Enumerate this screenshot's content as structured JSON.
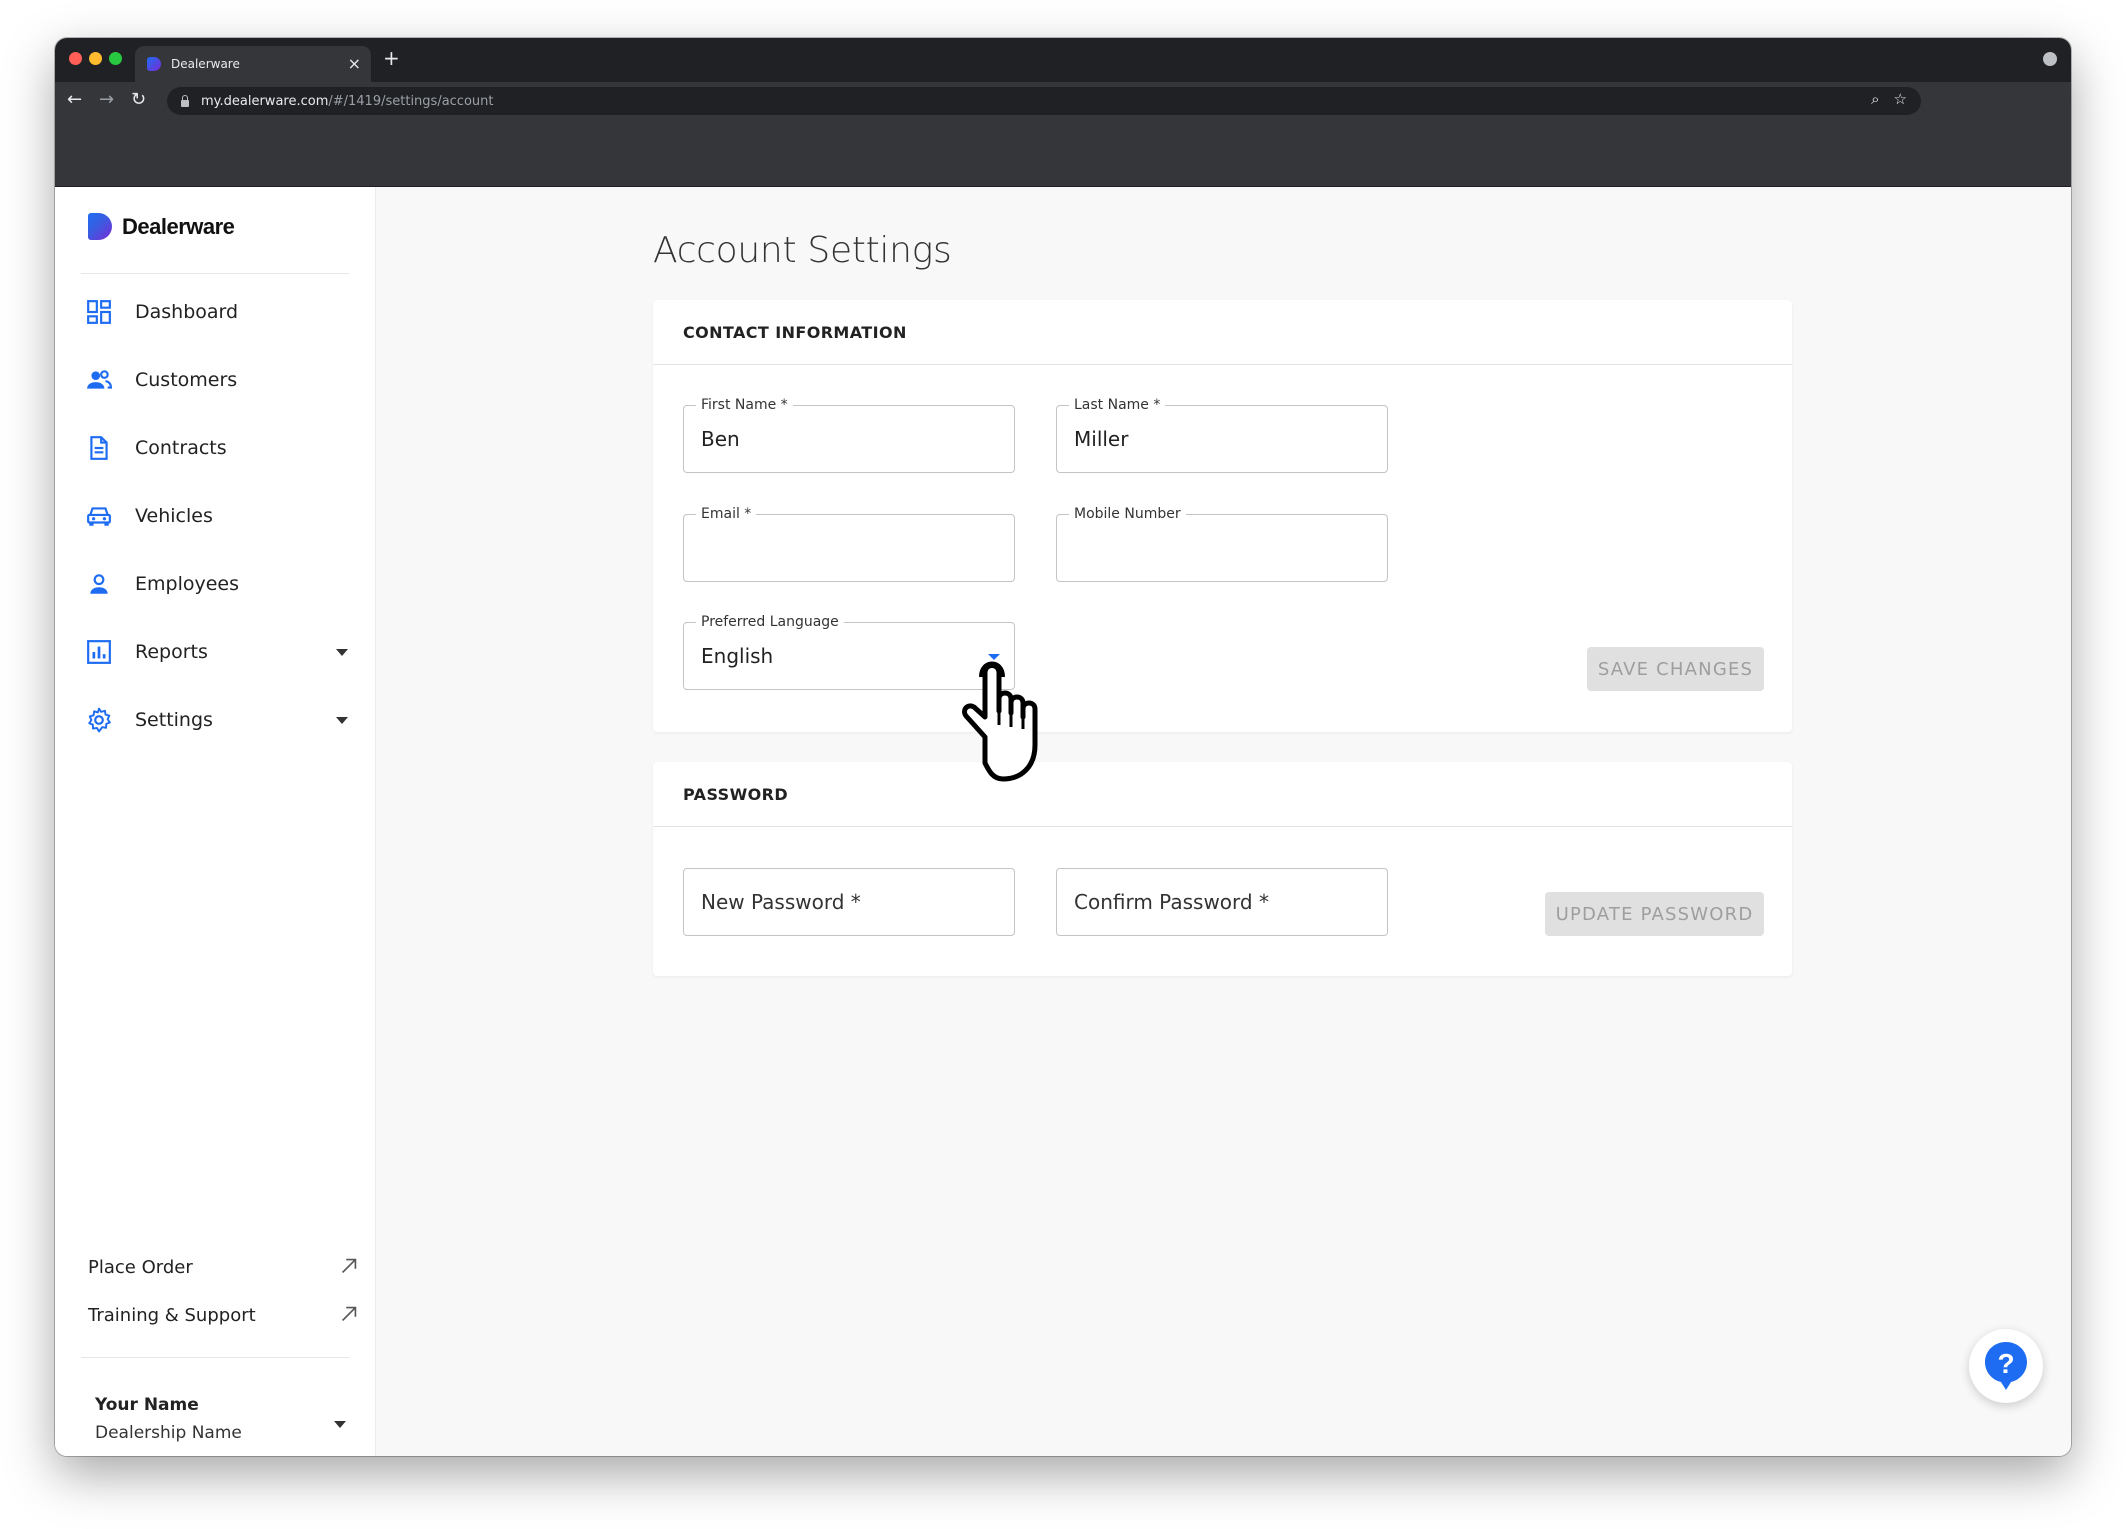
{
  "browser": {
    "tab_title": "Dealerware",
    "url_host": "my.dealerware.com",
    "url_path": "/#/1419/settings/account"
  },
  "sidebar": {
    "brand": "Dealerware",
    "items": [
      {
        "label": "Dashboard",
        "icon": "dashboard-icon"
      },
      {
        "label": "Customers",
        "icon": "customers-icon"
      },
      {
        "label": "Contracts",
        "icon": "contract-icon"
      },
      {
        "label": "Vehicles",
        "icon": "car-icon"
      },
      {
        "label": "Employees",
        "icon": "person-icon"
      },
      {
        "label": "Reports",
        "icon": "chart-icon",
        "expandable": true
      },
      {
        "label": "Settings",
        "icon": "gear-icon",
        "expandable": true
      }
    ],
    "links": [
      {
        "label": "Place Order",
        "icon": "external-arrow-icon"
      },
      {
        "label": "Training & Support",
        "icon": "external-arrow-icon"
      }
    ],
    "user": {
      "name": "Your Name",
      "dealership": "Dealership Name"
    }
  },
  "main": {
    "title": "Account Settings",
    "contact": {
      "header": "CONTACT INFORMATION",
      "first_name": {
        "label": "First Name *",
        "value": "Ben"
      },
      "last_name": {
        "label": "Last Name *",
        "value": "Miller"
      },
      "email": {
        "label": "Email *",
        "value": ""
      },
      "mobile": {
        "label": "Mobile Number",
        "value": ""
      },
      "language": {
        "label": "Preferred Language",
        "value": "English"
      },
      "save_label": "SAVE CHANGES"
    },
    "password": {
      "header": "PASSWORD",
      "new_placeholder": "New Password *",
      "confirm_placeholder": "Confirm Password *",
      "update_label": "UPDATE PASSWORD"
    }
  },
  "colors": {
    "accent": "#1e6cf2",
    "disabled_button": "#e0e0e0"
  }
}
